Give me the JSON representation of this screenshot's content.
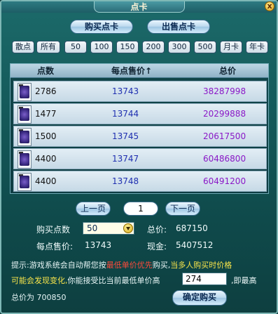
{
  "window": {
    "title": "点卡",
    "close": "x"
  },
  "tabs": {
    "buy": "购买点卡",
    "sell": "出售点卡"
  },
  "filters": [
    "散点",
    "所有",
    "50",
    "100",
    "150",
    "200",
    "300",
    "500",
    "月卡",
    "年卡"
  ],
  "table": {
    "headers": {
      "qty": "点数",
      "price": "每点售价↑",
      "total": "总价"
    },
    "rows": [
      {
        "qty": "2786",
        "price": "13743",
        "total": "38287998"
      },
      {
        "qty": "1477",
        "price": "13744",
        "total": "20299888"
      },
      {
        "qty": "1500",
        "price": "13745",
        "total": "20617500"
      },
      {
        "qty": "4400",
        "price": "13747",
        "total": "60486800"
      },
      {
        "qty": "4400",
        "price": "13748",
        "total": "60491200"
      }
    ]
  },
  "pager": {
    "prev": "上一页",
    "page": "1",
    "next": "下一页"
  },
  "purchase": {
    "qty_label": "购买点数",
    "qty_value": "50",
    "total_label": "总价:",
    "total_value": "687150",
    "unit_label": "每点售价:",
    "unit_value": "13743",
    "cash_label": "现金:",
    "cash_value": "5407512"
  },
  "hint": {
    "line1_a": "提示:游戏系统会自动帮您按",
    "line1_red": "最低单价优先",
    "line1_b": "购买,",
    "line1_yellow": "当多人购买时价格",
    "line2_yellow": "可能会发现变化,",
    "line2_a": "你能接受比当前最低单价高",
    "line2_value": "274",
    "line2_b": ",即最高",
    "line3_a": "总价为",
    "line3_value": "700850"
  },
  "confirm": "确定购买",
  "colors": {
    "price": "#1f2fb0",
    "total": "#8a18c7",
    "warn_red": "#ff4a3a",
    "warn_yellow": "#f7e44a"
  }
}
